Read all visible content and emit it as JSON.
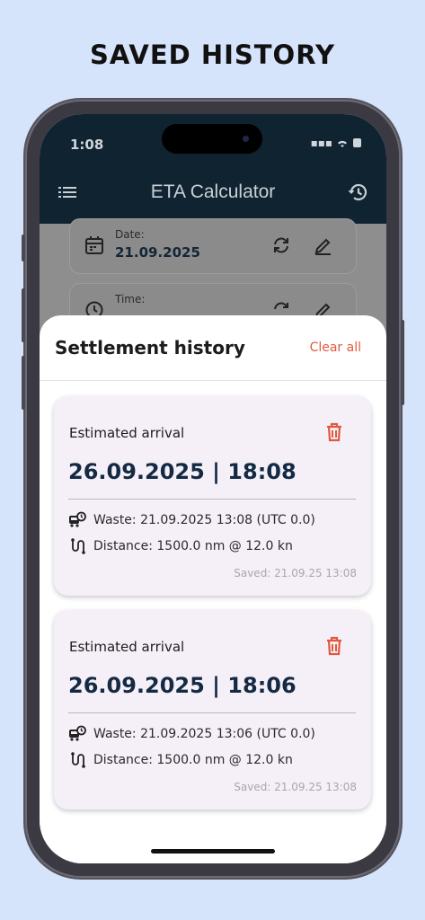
{
  "headline": "SAVED HISTORY",
  "status": {
    "time": "1:08"
  },
  "appbar": {
    "title": "ETA Calculator"
  },
  "background_fields": [
    {
      "label": "Date:",
      "value": "21.09.2025"
    },
    {
      "label": "Time:",
      "value": ""
    }
  ],
  "sheet": {
    "title": "Settlement history",
    "clear_all": "Clear all",
    "entries": [
      {
        "label": "Estimated arrival",
        "eta": "26.09.2025 | 18:08",
        "waste": "Waste: 21.09.2025 13:08 (UTC 0.0)",
        "distance": "Distance: 1500.0 nm @ 12.0 kn",
        "saved": "Saved: 21.09.25 13:08"
      },
      {
        "label": "Estimated arrival",
        "eta": "26.09.2025 | 18:06",
        "waste": "Waste: 21.09.2025 13:06 (UTC 0.0)",
        "distance": "Distance: 1500.0 nm @ 12.0 kn",
        "saved": "Saved: 21.09.25 13:08"
      }
    ]
  },
  "colors": {
    "accent": "#e05a40",
    "appbar": "#0f2331",
    "eta_text": "#142a43",
    "card_bg": "#f5f0f8",
    "page_bg": "#d6e4fb"
  }
}
